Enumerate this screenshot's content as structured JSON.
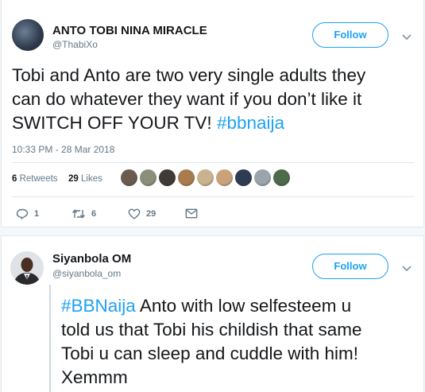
{
  "tweet1": {
    "display_name": "ANTO TOBI NINA MIRACLE",
    "handle": "@ThabiXo",
    "follow_label": "Follow",
    "text_lines": [
      "Tobi and Anto are two very single adults they",
      "can do whatever they want if you don’t like it"
    ],
    "text_line3": "SWITCH OFF YOUR TV! ",
    "hashtag": "#bbnaija",
    "timestamp": "10:33 PM - 28 Mar 2018",
    "retweets_count": "6",
    "retweets_label": "Retweets",
    "likes_count": "29",
    "likes_label": "Likes",
    "liker_colors": [
      "#6b5b4f",
      "#8a8f7a",
      "#3f3a36",
      "#a97c50",
      "#c9b28e",
      "#caa27a",
      "#2f3b52",
      "#9aa4ad",
      "#4d6a4a"
    ],
    "actions": {
      "replies": "1",
      "retweets": "6",
      "likes": "29"
    }
  },
  "tweet2": {
    "display_name": "Siyanbola OM",
    "handle": "@siyanbola_om",
    "follow_label": "Follow",
    "hashtag": "#BBNaija",
    "line1_rest": " Anto with low selfesteem u",
    "text_lines": [
      "told us that Tobi his childish that same",
      "Tobi u can sleep and cuddle with him!",
      "Xemmm"
    ]
  },
  "colors": {
    "accent": "#1da1f2",
    "text": "#14171a",
    "muted": "#657786",
    "border": "#e1e8ed"
  },
  "icons": {
    "chevron": "chevron-down-icon",
    "reply": "reply-icon",
    "retweet": "retweet-icon",
    "like": "heart-icon",
    "dm": "envelope-icon"
  }
}
